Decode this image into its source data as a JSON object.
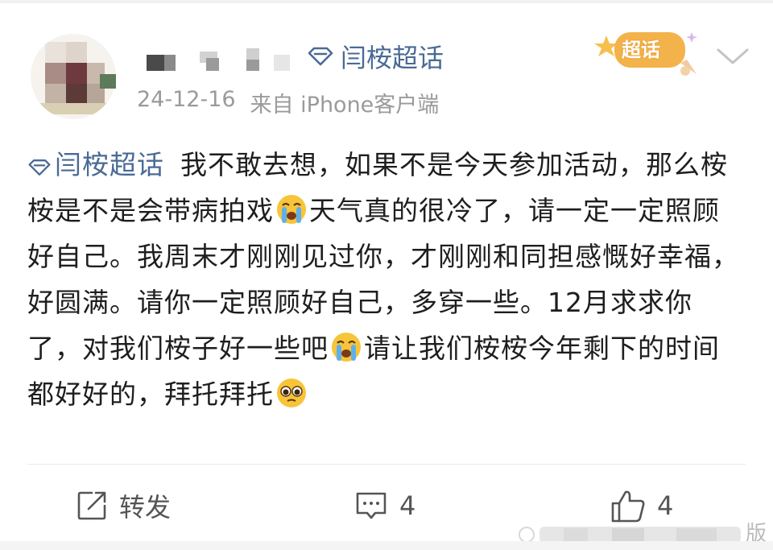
{
  "post": {
    "topic_name": "闫桉超话",
    "date": "24-12-16",
    "source_prefix": "来自",
    "source_client": "iPhone客户端",
    "badge_label": "超话",
    "content": {
      "tag": "闫桉超话",
      "segments": [
        "我不敢去想，如果不是今天参加活动，那么桉桉是不是会带病拍戏",
        "天气真的很冷了，请一定一定照顾好自己。我周末才刚刚见过你，才刚刚和同担感慨好幸福，好圆满。请你一定照顾好自己，多穿一些。12月求求你了，对我们桉子好一些吧",
        "请让我们桉桉今年剩下的时间都好好的，拜托拜托"
      ],
      "emojis": [
        "crying-emoji",
        "crying-emoji",
        "pleading-emoji"
      ]
    }
  },
  "actions": {
    "repost_label": "转发",
    "comment_count": "4",
    "like_count": "4"
  },
  "watermark": {
    "visible_char": "版"
  },
  "colors": {
    "link": "#4a6a95",
    "meta": "#9a9a9a",
    "text": "#1e1e1e",
    "badge": "#f3b24a"
  },
  "icons": {
    "topic": "diamond-icon",
    "more": "chevron-down-icon",
    "repost": "repost-icon",
    "comment": "comment-icon",
    "like": "thumbs-up-icon"
  }
}
